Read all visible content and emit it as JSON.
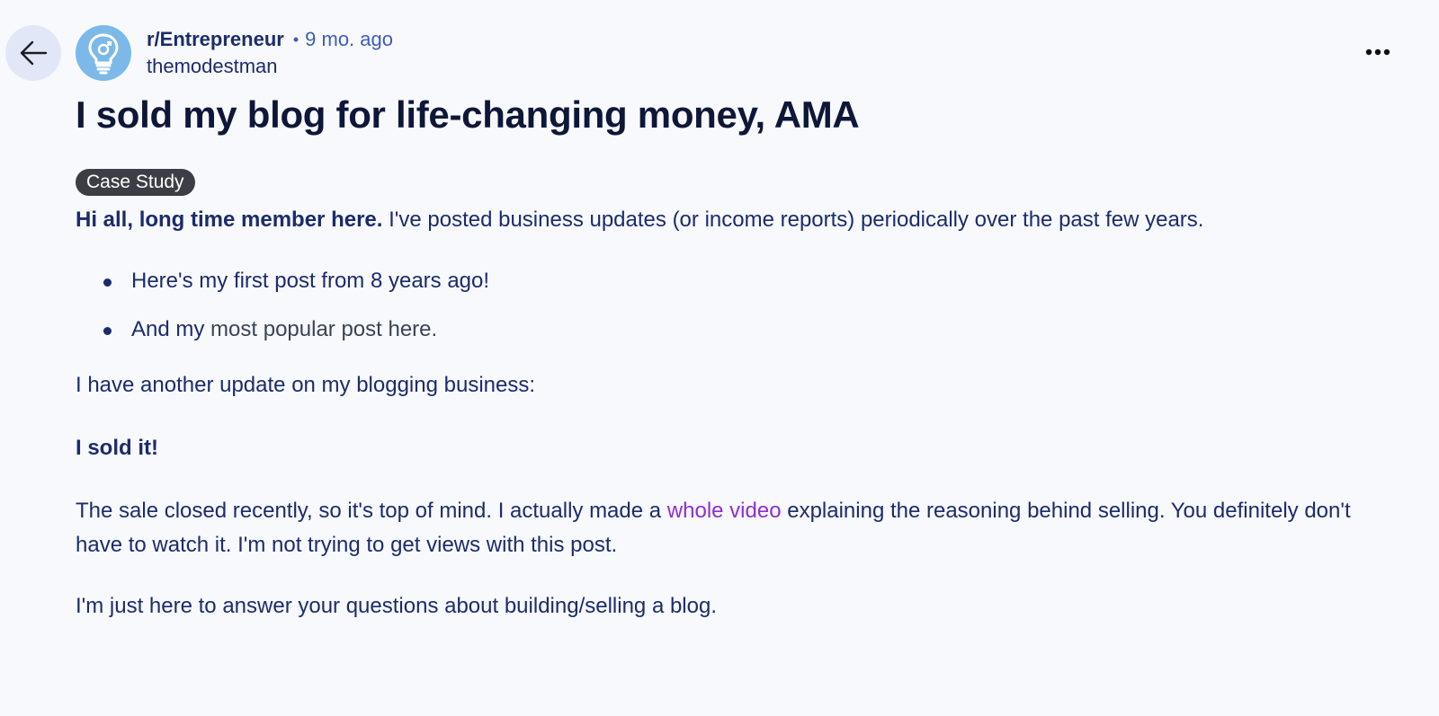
{
  "post": {
    "subreddit": "r/Entrepreneur",
    "separator": "•",
    "time_ago": "9 mo. ago",
    "author": "themodestman",
    "title": "I sold my blog for life-changing money, AMA",
    "flair": "Case Study"
  },
  "body": {
    "intro_bold": "Hi all, long time member here.",
    "intro_rest": " I've posted business updates (or income reports) periodically over the past few years.",
    "bullets": [
      {
        "text": "Here's my first post from 8 years ago!"
      },
      {
        "text_a": "And my",
        "text_b": " most popular post here."
      }
    ],
    "update_line": "I have another update on my blogging business:",
    "sold_line": "I sold it!",
    "sale_before": "The sale closed recently, so it's top of mind. I actually made a ",
    "sale_link": "whole video",
    "sale_after": " explaining the reasoning behind selling. You definitely don't have to watch it. I'm not trying to get views with this post.",
    "last_line": "I'm just here to answer your questions about building/selling a blog."
  },
  "icons": {
    "back": "arrow-left-icon",
    "avatar": "lightbulb-icon",
    "more": "ellipsis-icon"
  },
  "colors": {
    "background": "#f8f9fd",
    "text": "#1b2c6b",
    "title": "#0e1738",
    "link": "#8e2fd1",
    "flair_bg": "#3b3f45",
    "avatar_bg": "#7cb9e8"
  }
}
